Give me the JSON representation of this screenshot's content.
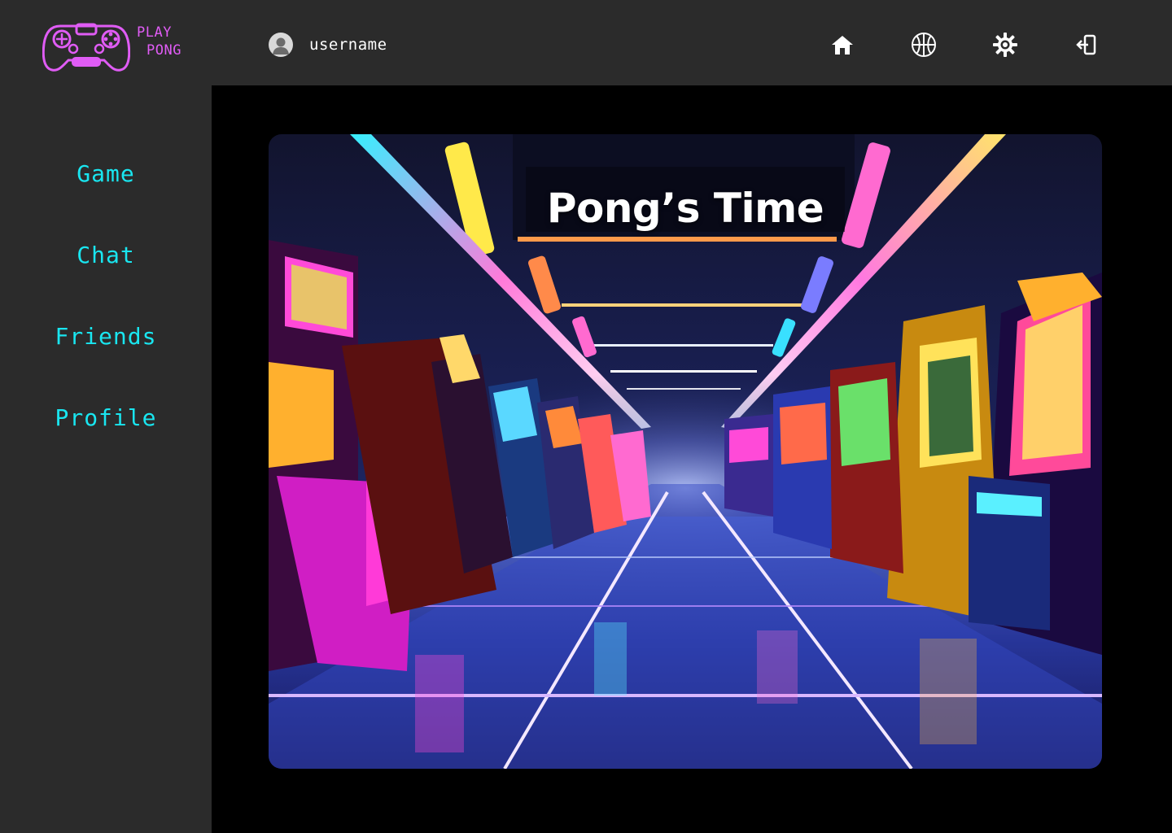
{
  "brand": {
    "line1": "PLAY",
    "line2": "PONG",
    "color": "#e05cf5",
    "icon": "gamepad-icon"
  },
  "user": {
    "name": "username",
    "avatar_icon": "user-avatar-icon"
  },
  "header_icons": [
    {
      "name": "home-icon",
      "label": "Home"
    },
    {
      "name": "basketball-icon",
      "label": "Game"
    },
    {
      "name": "gear-icon",
      "label": "Settings"
    },
    {
      "name": "logout-icon",
      "label": "Logout"
    }
  ],
  "sidebar": {
    "items": [
      {
        "label": "Game"
      },
      {
        "label": "Chat"
      },
      {
        "label": "Friends"
      },
      {
        "label": "Profile"
      }
    ],
    "accent": "#19e6f0"
  },
  "hero": {
    "title": "Pong’s Time",
    "image": "neon-arcade-hallway-image"
  },
  "colors": {
    "topbar_bg": "#2b2b2b",
    "sidebar_bg": "#2b2b2b",
    "main_bg": "#000000"
  }
}
